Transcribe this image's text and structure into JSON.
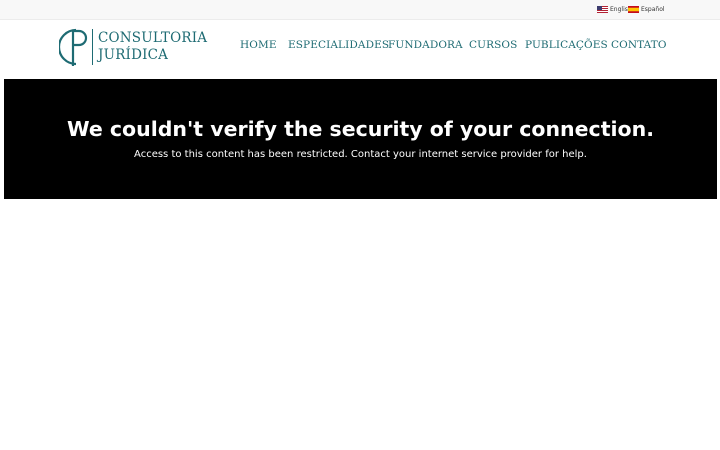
{
  "languages": [
    {
      "label": "English",
      "icon": "us-flag-icon"
    },
    {
      "label": "Español",
      "icon": "spain-flag-icon"
    }
  ],
  "logo": {
    "monogram": "CP",
    "line1": "CONSULTORIA",
    "line2": "JURÍDICA",
    "color": "#1e6b73"
  },
  "nav": {
    "items": [
      {
        "label": "HOME"
      },
      {
        "label": "ESPECIALIDADES"
      },
      {
        "label": "FUNDADORA"
      },
      {
        "label": "CURSOS"
      },
      {
        "label": "PUBLICAÇÕES"
      },
      {
        "label": "CONTATO"
      }
    ]
  },
  "banner": {
    "title": "We couldn't verify the security of your connection.",
    "message": "Access to this content has been restricted. Contact your internet service provider for help.",
    "background": "#000000"
  }
}
